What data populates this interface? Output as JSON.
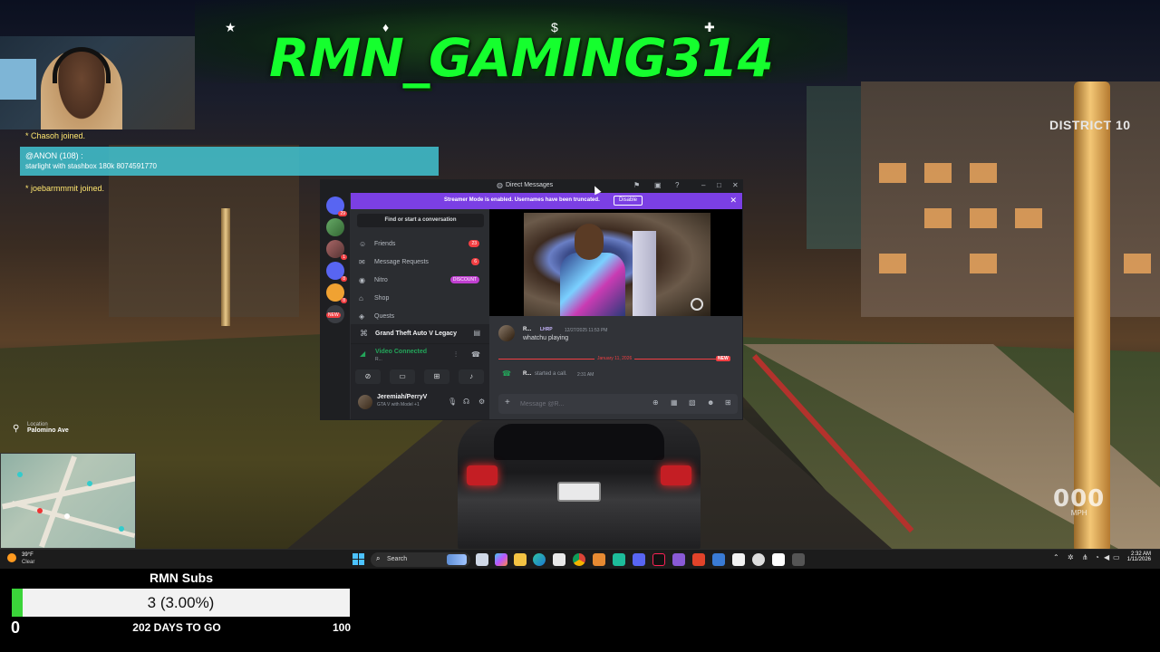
{
  "overlay": {
    "brand_title": "RMN_GAMING314",
    "district_label": "DISTRICT 10",
    "banner_icons": [
      "star-icon",
      "diamond-icon",
      "dollar-icon",
      "add-user-icon"
    ]
  },
  "chat": {
    "join_1": "* Chasoh joined.",
    "highlight_user": "@ANON (108) :",
    "highlight_message": "starlight with stashbox 180k 8074591770",
    "join_2": "* joebarmmmit joined."
  },
  "location": {
    "label": "Location",
    "street": "Palomino Ave"
  },
  "speedometer": {
    "speed": "000",
    "unit": "MPH"
  },
  "discord": {
    "window_title": "Direct Messages",
    "streamer_bar_text": "Streamer Mode is enabled. Usernames have been truncated.",
    "streamer_bar_button": "Disable",
    "dm_search_placeholder": "Find or start a conversation",
    "nav": [
      {
        "label": "Friends",
        "badge": "23",
        "icon": "friends-icon"
      },
      {
        "label": "Message Requests",
        "badge": "6",
        "icon": "inbox-icon"
      },
      {
        "label": "Nitro",
        "badge": "DISCOUNT",
        "icon": "nitro-icon"
      },
      {
        "label": "Shop",
        "badge": "",
        "icon": "shop-icon"
      },
      {
        "label": "Quests",
        "badge": "",
        "icon": "quests-icon"
      }
    ],
    "guild_badges": [
      "29",
      "",
      "1",
      "8",
      "8",
      "NEW"
    ],
    "game_activity": "Grand Theft Auto V Legacy",
    "voice_status": "Video Connected",
    "voice_sub": "R...",
    "user_name": "Jeremiah/PerryV",
    "user_status": "GTA V with Model +1",
    "message": {
      "author": "R...",
      "tag": "LHRP",
      "time": "12/27/2025 11:53 PM",
      "text": "whatchu playing"
    },
    "divider_date": "January 11, 2026",
    "divider_new": "NEW",
    "call": {
      "user": "R...",
      "text": "started a call.",
      "time": "2:31 AM"
    },
    "composer_placeholder": "Message @R..."
  },
  "taskbar": {
    "weather_temp": "39°F",
    "weather_cond": "Clear",
    "search_label": "Search",
    "time": "2:32 AM",
    "date": "1/11/2026"
  },
  "sub_goal": {
    "title": "RMN Subs",
    "current_display": "3 (3.00%)",
    "current": 3,
    "goal": 100,
    "progress_fraction": 0.03,
    "min_label": "0",
    "max_label": "100",
    "days_label": "202 DAYS TO GO"
  },
  "colors": {
    "brand_green": "#15ff2e",
    "discord_purple": "#7b3fe4",
    "discord_red": "#f23f43",
    "discord_green": "#23a55a",
    "sub_fill": "#3bd43a"
  }
}
